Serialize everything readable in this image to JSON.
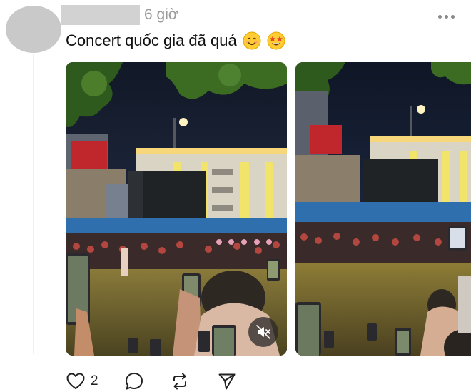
{
  "post": {
    "time": "6 giờ",
    "text": "Concert quốc gia đã quá",
    "emojis": [
      "smiling-face",
      "star-struck-face"
    ],
    "media_count": 2,
    "like_count": "2"
  },
  "icons": {
    "more": "ellipsis-icon",
    "mute": "speaker-muted-icon",
    "like": "heart-icon",
    "reply": "comment-icon",
    "repost": "repost-icon",
    "share": "send-icon"
  },
  "colors": {
    "meta_text": "#9a9a9a",
    "avatar_placeholder": "#c9c9c9",
    "icon": "#222222"
  }
}
